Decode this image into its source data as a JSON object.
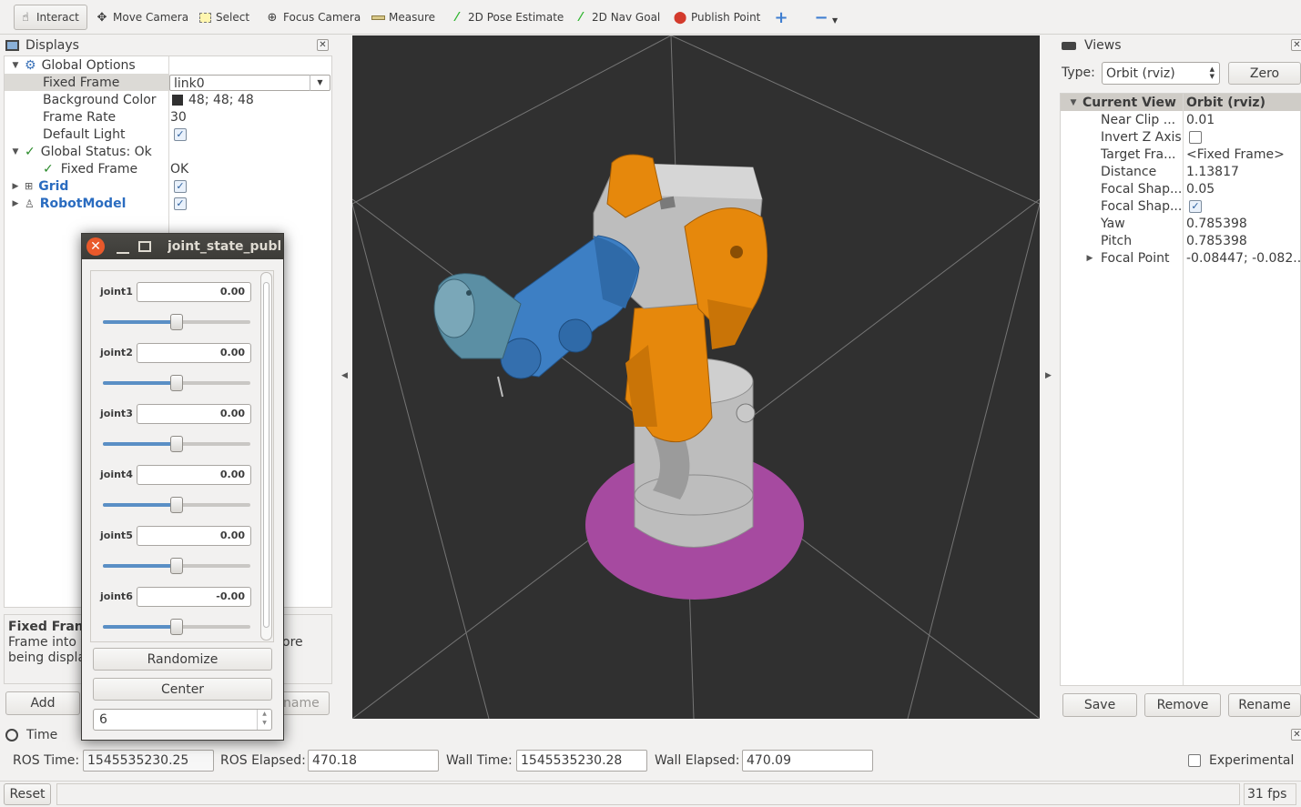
{
  "toolbar": {
    "interact": "Interact",
    "move_camera": "Move Camera",
    "select": "Select",
    "focus_camera": "Focus Camera",
    "measure": "Measure",
    "pose_estimate": "2D Pose Estimate",
    "nav_goal": "2D Nav Goal",
    "publish_point": "Publish Point"
  },
  "displays": {
    "title": "Displays",
    "global_options": "Global Options",
    "fixed_frame_label": "Fixed Frame",
    "fixed_frame_value": "link0",
    "background_color_label": "Background Color",
    "background_color_value": "48; 48; 48",
    "frame_rate_label": "Frame Rate",
    "frame_rate_value": "30",
    "default_light_label": "Default Light",
    "global_status_label": "Global Status: Ok",
    "fixed_frame_status_label": "Fixed Frame",
    "fixed_frame_status_value": "OK",
    "grid_label": "Grid",
    "robotmodel_label": "RobotModel",
    "desc_title": "Fixed Frame",
    "desc_line1": "Frame into v",
    "desc_line1_end": "ore",
    "desc_line2": "being displa",
    "add_button": "Add",
    "rename_button_partial": "name"
  },
  "joint_state_publisher": {
    "title": "joint_state_publ",
    "joints": [
      {
        "label": "joint1",
        "value": "0.00",
        "slider": 0.5
      },
      {
        "label": "joint2",
        "value": "0.00",
        "slider": 0.5
      },
      {
        "label": "joint3",
        "value": "0.00",
        "slider": 0.5
      },
      {
        "label": "joint4",
        "value": "0.00",
        "slider": 0.5
      },
      {
        "label": "joint5",
        "value": "0.00",
        "slider": 0.5
      },
      {
        "label": "joint6",
        "value": "-0.00",
        "slider": 0.5
      }
    ],
    "randomize_button": "Randomize",
    "center_button": "Center",
    "spin_value": "6"
  },
  "views": {
    "title": "Views",
    "type_label": "Type:",
    "type_value": "Orbit (rviz)",
    "zero_button": "Zero",
    "header_left": "Current View",
    "header_right": "Orbit (rviz)",
    "props": [
      {
        "label": "Near Clip ...",
        "value": "0.01"
      },
      {
        "label": "Invert Z Axis",
        "value": ""
      },
      {
        "label": "Target Fra...",
        "value": "<Fixed Frame>"
      },
      {
        "label": "Distance",
        "value": "1.13817"
      },
      {
        "label": "Focal Shap...",
        "value": "0.05"
      },
      {
        "label": "Focal Shap...",
        "value": ""
      },
      {
        "label": "Yaw",
        "value": "0.785398"
      },
      {
        "label": "Pitch",
        "value": "0.785398"
      },
      {
        "label": "Focal Point",
        "value": "-0.08447; -0.082..."
      }
    ],
    "save_button": "Save",
    "remove_button": "Remove",
    "rename_button": "Rename"
  },
  "time": {
    "title": "Time",
    "ros_time_label": "ROS Time:",
    "ros_time_value": "1545535230.25",
    "ros_elapsed_label": "ROS Elapsed:",
    "ros_elapsed_value": "470.18",
    "wall_time_label": "Wall Time:",
    "wall_time_value": "1545535230.28",
    "wall_elapsed_label": "Wall Elapsed:",
    "wall_elapsed_value": "470.09",
    "experimental_label": "Experimental"
  },
  "status": {
    "reset_button": "Reset",
    "fps": "31 fps"
  },
  "colors": {
    "viewport_bg": "#303030",
    "robot_orange": "#e6880c",
    "robot_blue": "#3d7fc4",
    "robot_grey": "#b8b8b8",
    "base_magenta": "#a64aa0",
    "link_blue": "#2366b6"
  }
}
